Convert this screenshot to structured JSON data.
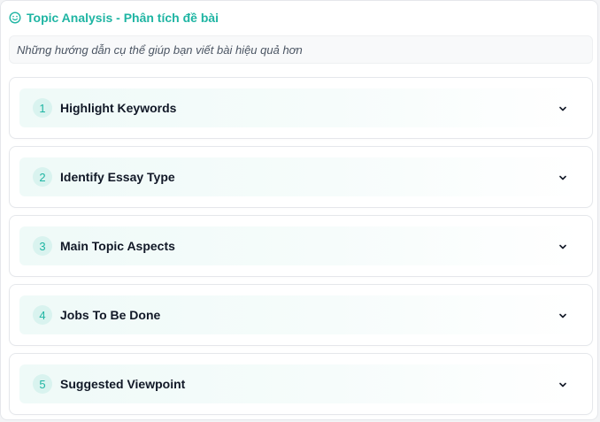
{
  "header": {
    "icon": "smile-icon",
    "title": "Topic Analysis - Phân tích đề bài",
    "accent_color": "#1fb5a3"
  },
  "hint": {
    "text": "Những hướng dẫn cụ thể giúp bạn viết bài hiệu quả hơn"
  },
  "steps": [
    {
      "number": "1",
      "title": "Highlight Keywords",
      "icon": "chevron-down-icon"
    },
    {
      "number": "2",
      "title": "Identify Essay Type",
      "icon": "chevron-down-icon"
    },
    {
      "number": "3",
      "title": "Main Topic Aspects",
      "icon": "chevron-down-icon"
    },
    {
      "number": "4",
      "title": "Jobs To Be Done",
      "icon": "chevron-down-icon"
    },
    {
      "number": "5",
      "title": "Suggested Viewpoint",
      "icon": "chevron-down-icon"
    }
  ]
}
